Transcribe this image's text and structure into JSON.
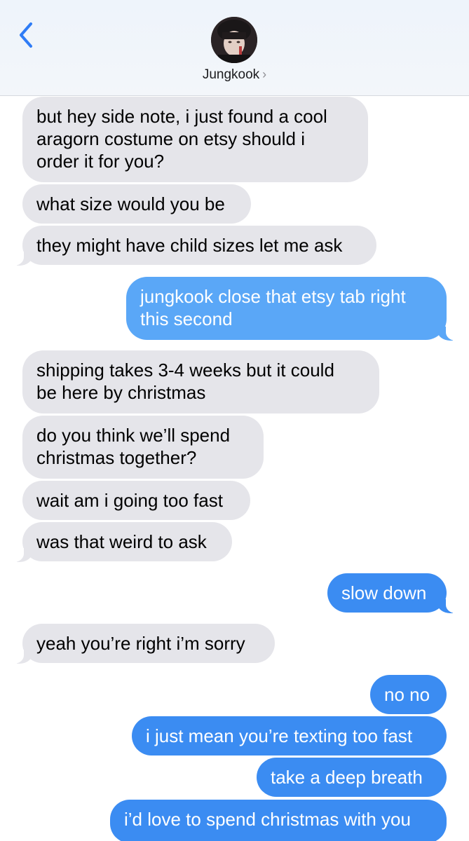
{
  "header": {
    "contact_name": "Jungkook",
    "chevron": "›",
    "back_icon": "chevron-left-icon",
    "avatar_icon": "contact-photo"
  },
  "colors": {
    "incoming": "#e5e5ea",
    "outgoing": "#3b8cf2",
    "accent": "#2f7cf6"
  },
  "messages": [
    {
      "side": "in",
      "lines": [
        "but hey side note, i just found a cool",
        "aragorn costume on etsy should i",
        "order it for you?"
      ]
    },
    {
      "side": "in",
      "lines": [
        "what size would you be"
      ]
    },
    {
      "side": "in",
      "lines": [
        "they might have child sizes let me ask"
      ]
    },
    {
      "side": "out",
      "lines": [
        "jungkook close that etsy tab right",
        "this second"
      ]
    },
    {
      "side": "in",
      "lines": [
        "shipping takes 3-4 weeks but it could",
        "be here by christmas"
      ]
    },
    {
      "side": "in",
      "lines": [
        "do you think we’ll spend",
        "christmas together?"
      ]
    },
    {
      "side": "in",
      "lines": [
        "wait am i going too fast"
      ]
    },
    {
      "side": "in",
      "lines": [
        "was that weird to ask"
      ]
    },
    {
      "side": "out",
      "lines": [
        "slow down"
      ]
    },
    {
      "side": "in",
      "lines": [
        "yeah you’re right i’m sorry"
      ]
    },
    {
      "side": "out",
      "lines": [
        "no no"
      ]
    },
    {
      "side": "out",
      "lines": [
        "i just mean you’re texting too fast"
      ]
    },
    {
      "side": "out",
      "lines": [
        "take a deep breath"
      ]
    },
    {
      "side": "out",
      "lines": [
        "i’d love to spend christmas with you"
      ]
    }
  ]
}
